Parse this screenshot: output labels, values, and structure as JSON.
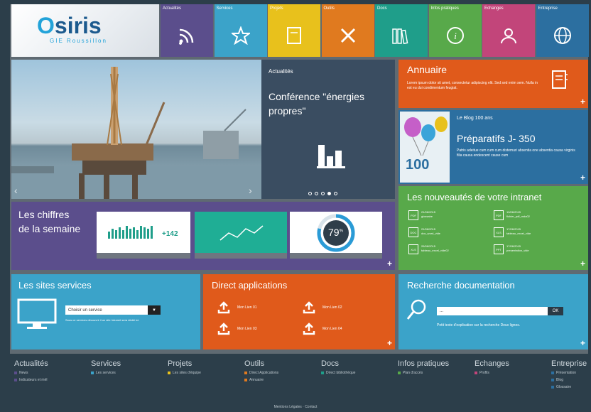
{
  "header": {
    "logo_text": "siris",
    "logo_o": "O",
    "logo_sub": "GIE Roussillon",
    "nav": [
      {
        "label": "Actualités",
        "color": "#5b4e8c",
        "icon": "rss-icon"
      },
      {
        "label": "Services",
        "color": "#3ba3c9",
        "icon": "star-icon"
      },
      {
        "label": "Projets",
        "color": "#e8c11c",
        "icon": "book-icon"
      },
      {
        "label": "Outils",
        "color": "#e07a1f",
        "icon": "tools-icon"
      },
      {
        "label": "Docs",
        "color": "#1f9e8a",
        "icon": "library-icon"
      },
      {
        "label": "Infos pratiques",
        "color": "#58a94a",
        "icon": "info-icon"
      },
      {
        "label": "Echanges",
        "color": "#c2457a",
        "icon": "users-icon"
      },
      {
        "label": "Entreprise",
        "color": "#2c6fa0",
        "icon": "globe-icon"
      }
    ]
  },
  "news": {
    "section": "Actualités",
    "title": "Conférence \"énergies propres\""
  },
  "annuaire": {
    "title": "Annuaire",
    "text": "Lorem ipsum dolor sit amet, consectetur adipiscing elit. Sed sed enim sem. Nulla in est eu dui condimentum feugiat."
  },
  "blog": {
    "section": "Le Blog 100 ans",
    "title": "Préparatifs J- 350",
    "text": "Patris adeitue cum cum cum distemuri absentia one absentia causa virginis filia causa endescent cause cum",
    "badge": "100"
  },
  "chiffres": {
    "title_line1": "Les chiffres",
    "title_line2": "de la semaine",
    "stat_value": "+142",
    "gauge_value": "79",
    "gauge_unit": "%",
    "gauge_fraction": 0.79
  },
  "nouveautes": {
    "title": "Les nouveautés de votre intranet",
    "items": [
      {
        "type": "PDF",
        "date": "21/06/2015",
        "name": "glossaire"
      },
      {
        "type": "PDF",
        "date": "19/06/2015",
        "name": "fichier_pdf_mda02"
      },
      {
        "type": "DOC",
        "date": "21/06/2015",
        "name": "doc_word_vlde"
      },
      {
        "type": "XLS",
        "date": "17/06/2015",
        "name": "tableau_excel_vide"
      },
      {
        "type": "XLS",
        "date": "26/06/2015",
        "name": "tableau_excel_vide02"
      },
      {
        "type": "PPT",
        "date": "17/06/2015",
        "name": "presentation_vide"
      }
    ]
  },
  "sites": {
    "title": "Les sites services",
    "select_value": "Choisir un service",
    "help": "Sous ce services découvrir il un site Intranet sera dédié ici."
  },
  "direct": {
    "title": "Direct applications",
    "links": [
      "Mon Lien 01",
      "Mon Lien 02",
      "Mon Lien 03",
      "Mon Lien 04"
    ]
  },
  "recherche": {
    "title": "Recherche documentation",
    "input_value": "...",
    "button": "OK",
    "text": "Petit texte d'explication sur la recherche Deux lignes."
  },
  "footer": {
    "columns": [
      {
        "title": "Actualités",
        "color": "#5b4e8c",
        "items": [
          "News",
          "Indicateurs et mél"
        ]
      },
      {
        "title": "Services",
        "color": "#3ba3c9",
        "items": [
          "Les services"
        ]
      },
      {
        "title": "Projets",
        "color": "#e8c11c",
        "items": [
          "Les sites d'équipe"
        ]
      },
      {
        "title": "Outils",
        "color": "#e07a1f",
        "items": [
          "Direct Applications",
          "Annuaire"
        ]
      },
      {
        "title": "Docs",
        "color": "#1f9e8a",
        "items": [
          "Direct bibliothèque"
        ]
      },
      {
        "title": "Infos pratiques",
        "color": "#58a94a",
        "items": [
          "Plan d'accès"
        ]
      },
      {
        "title": "Echanges",
        "color": "#c2457a",
        "items": [
          "Profils"
        ]
      },
      {
        "title": "Entreprise",
        "color": "#2c6fa0",
        "items": [
          "Présentation",
          "Blog",
          "Glossaire"
        ]
      }
    ],
    "bottom": "Mentions Légales · Contact"
  }
}
